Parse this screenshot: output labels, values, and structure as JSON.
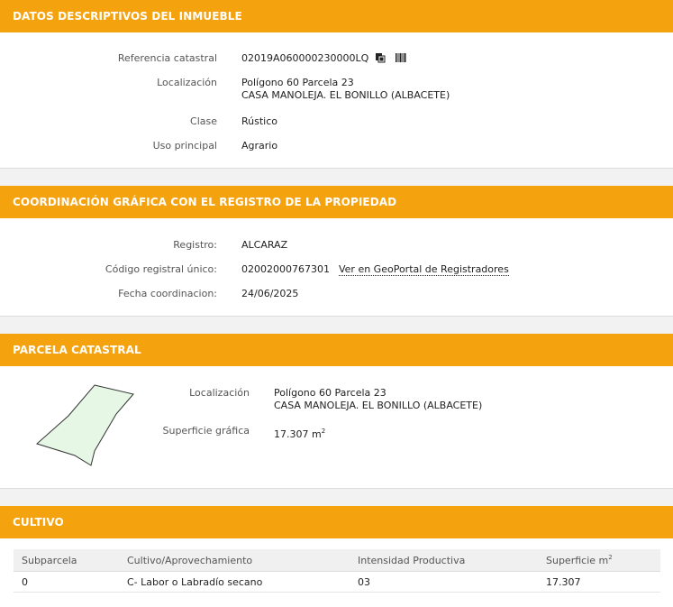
{
  "descriptivos": {
    "title": "DATOS DESCRIPTIVOS DEL INMUEBLE",
    "ref_label": "Referencia catastral",
    "ref_value": "02019A060000230000LQ",
    "loc_label": "Localización",
    "loc_line1": "Polígono 60 Parcela 23",
    "loc_line2": "CASA MANOLEJA. EL BONILLO (ALBACETE)",
    "clase_label": "Clase",
    "clase_value": "Rústico",
    "uso_label": "Uso principal",
    "uso_value": "Agrario"
  },
  "coordinacion": {
    "title": "COORDINACIÓN GRÁFICA CON EL REGISTRO DE LA PROPIEDAD",
    "registro_label": "Registro:",
    "registro_value": "ALCARAZ",
    "codigo_label": "Código registral único:",
    "codigo_value": "02002000767301",
    "geoportal_link": "Ver en GeoPortal de Registradores",
    "fecha_label": "Fecha coordinacion:",
    "fecha_value": "24/06/2025"
  },
  "parcela": {
    "title": "PARCELA CATASTRAL",
    "loc_label": "Localización",
    "loc_line1": "Polígono 60 Parcela 23",
    "loc_line2": "CASA MANOLEJA. EL BONILLO (ALBACETE)",
    "sup_label": "Superficie gráfica",
    "sup_value": "17.307 m",
    "sup_unit_exp": "2"
  },
  "cultivo": {
    "title": "CULTIVO",
    "headers": [
      "Subparcela",
      "Cultivo/Aprovechamiento",
      "Intensidad Productiva",
      "Superficie m"
    ],
    "header_exp": "2",
    "rows": [
      [
        "0",
        "C- Labor o Labradío secano",
        "03",
        "17.307"
      ]
    ]
  },
  "colors": {
    "accent": "#f5a20f",
    "parcel_fill": "#e6f7e6"
  },
  "icons": [
    "copy-icon",
    "barcode-icon"
  ]
}
